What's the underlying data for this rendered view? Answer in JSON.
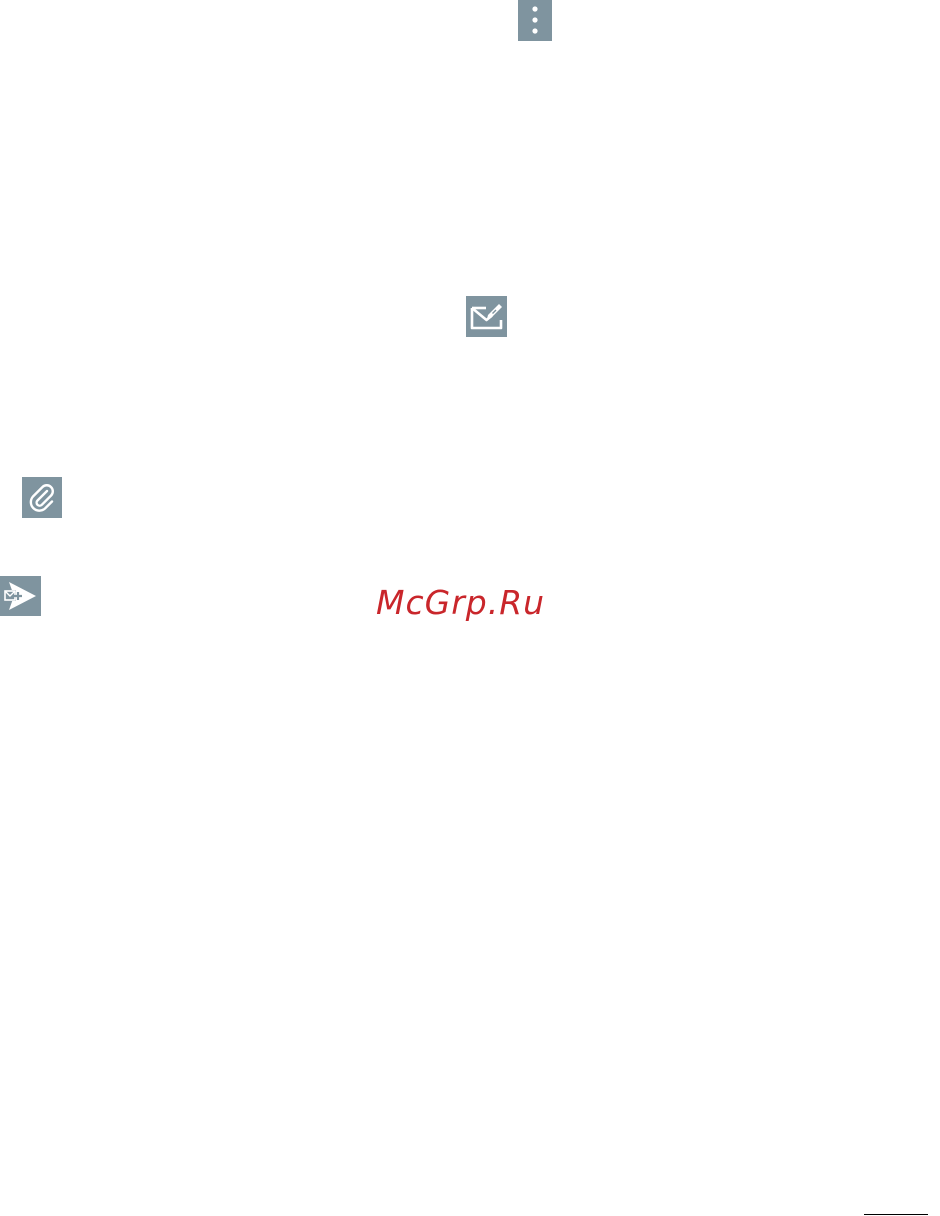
{
  "icons": {
    "menu": "more-vertical-icon",
    "compose": "compose-email-icon",
    "attach": "paperclip-icon",
    "send": "send-email-icon"
  },
  "colors": {
    "icon_background": "#7f949f",
    "icon_foreground": "#ffffff",
    "watermark": "#c9262b"
  },
  "watermark": {
    "text": "McGrp.Ru"
  }
}
